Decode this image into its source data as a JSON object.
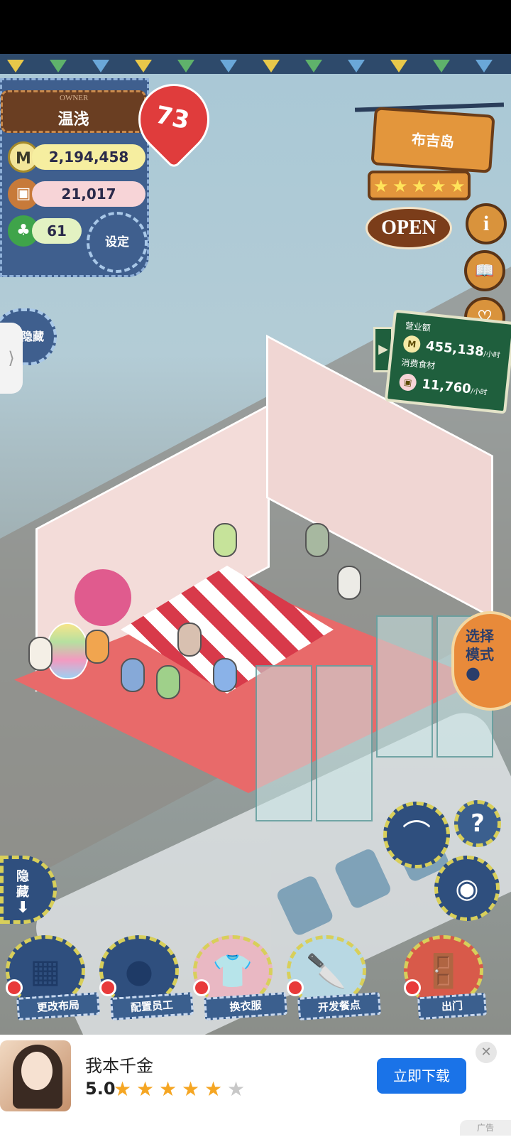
{
  "owner": {
    "label": "OWNER",
    "name": "温浅",
    "level": "73"
  },
  "stats": {
    "coins": "2,194,458",
    "ingredients": "21,017",
    "clover": "61"
  },
  "buttons": {
    "settings": "设定",
    "hide_top": "隐藏",
    "hide_bottom_1": "隐",
    "hide_bottom_2": "藏",
    "select_mode_1": "选择",
    "select_mode_2": "模式"
  },
  "shop": {
    "name": "布吉岛",
    "stars": 5,
    "open_label": "OPEN"
  },
  "sales": {
    "revenue_label": "营业额",
    "revenue_value": "455,138",
    "unit": "/小时",
    "consumption_label": "消费食材",
    "consumption_value": "11,760"
  },
  "toolbar": [
    {
      "label": "更改布局",
      "icon": "furniture-icon"
    },
    {
      "label": "配置员工",
      "icon": "bear-head-icon"
    },
    {
      "label": "换衣服",
      "icon": "shirt-icon"
    },
    {
      "label": "开发餐点",
      "icon": "knife-icon"
    },
    {
      "label": "出门",
      "icon": "door-icon"
    }
  ],
  "ad": {
    "title": "我本千金",
    "score": "5.0",
    "cta": "立即下载",
    "tag": "广告",
    "rating": 4
  },
  "colors": {
    "panel_blue": "#3f5f8e",
    "accent_orange": "#e3963c",
    "cta_blue": "#1a73e8"
  }
}
